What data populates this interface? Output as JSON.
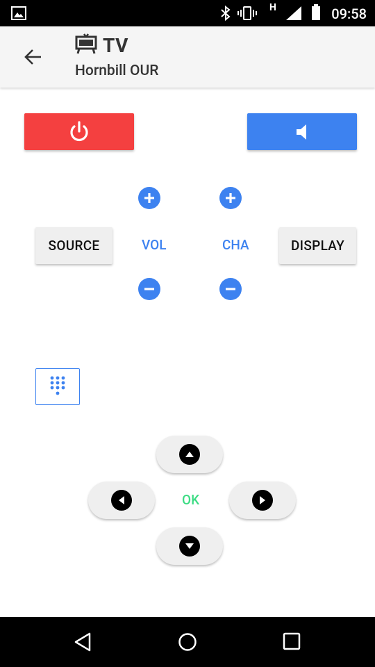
{
  "status_bar": {
    "time": "09:58",
    "icons": [
      "image-icon",
      "bluetooth-icon",
      "vibrate-icon",
      "h-network-icon",
      "signal-icon",
      "battery-icon"
    ],
    "network_letter": "H"
  },
  "header": {
    "device_icon": "tv-icon",
    "title": "TV",
    "subtitle": "Hornbill OUR"
  },
  "controls": {
    "power_icon": "power-icon",
    "mute_icon": "volume-icon",
    "source_label": "SOURCE",
    "display_label": "DISPLAY",
    "vol_label": "VOL",
    "cha_label": "CHA",
    "keypad_icon": "dialpad-icon"
  },
  "dpad": {
    "ok_label": "OK"
  },
  "colors": {
    "power": "#f44040",
    "accent_blue": "#3d82f0",
    "ok_green": "#3ddc84",
    "button_grey": "#efefef"
  }
}
